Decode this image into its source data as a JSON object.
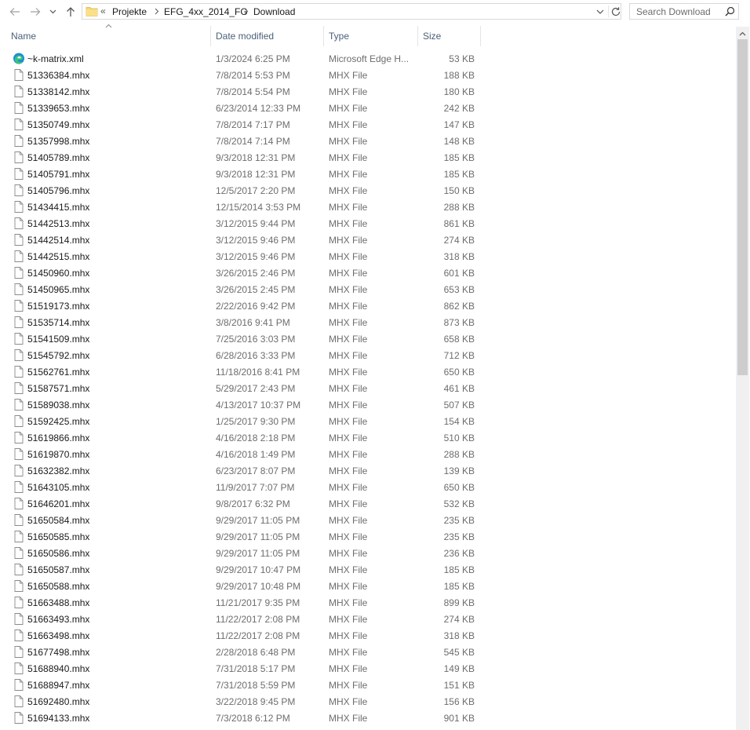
{
  "address": {
    "overflow_chevron": "«",
    "crumbs": [
      "Projekte",
      "EFG_4xx_2014_FG",
      "Download"
    ]
  },
  "search": {
    "placeholder": "Search Download"
  },
  "columns": {
    "name": "Name",
    "date": "Date modified",
    "type": "Type",
    "size": "Size"
  },
  "files": [
    {
      "name": "~k-matrix.xml",
      "date": "1/3/2024 6:25 PM",
      "type": "Microsoft Edge H...",
      "size": "53 KB",
      "icon": "edge-icon"
    },
    {
      "name": "51336384.mhx",
      "date": "7/8/2014 5:53 PM",
      "type": "MHX File",
      "size": "188 KB",
      "icon": "file-icon"
    },
    {
      "name": "51338142.mhx",
      "date": "7/8/2014 5:54 PM",
      "type": "MHX File",
      "size": "180 KB",
      "icon": "file-icon"
    },
    {
      "name": "51339653.mhx",
      "date": "6/23/2014 12:33 PM",
      "type": "MHX File",
      "size": "242 KB",
      "icon": "file-icon"
    },
    {
      "name": "51350749.mhx",
      "date": "7/8/2014 7:17 PM",
      "type": "MHX File",
      "size": "147 KB",
      "icon": "file-icon"
    },
    {
      "name": "51357998.mhx",
      "date": "7/8/2014 7:14 PM",
      "type": "MHX File",
      "size": "148 KB",
      "icon": "file-icon"
    },
    {
      "name": "51405789.mhx",
      "date": "9/3/2018 12:31 PM",
      "type": "MHX File",
      "size": "185 KB",
      "icon": "file-icon"
    },
    {
      "name": "51405791.mhx",
      "date": "9/3/2018 12:31 PM",
      "type": "MHX File",
      "size": "185 KB",
      "icon": "file-icon"
    },
    {
      "name": "51405796.mhx",
      "date": "12/5/2017 2:20 PM",
      "type": "MHX File",
      "size": "150 KB",
      "icon": "file-icon"
    },
    {
      "name": "51434415.mhx",
      "date": "12/15/2014 3:53 PM",
      "type": "MHX File",
      "size": "288 KB",
      "icon": "file-icon"
    },
    {
      "name": "51442513.mhx",
      "date": "3/12/2015 9:44 PM",
      "type": "MHX File",
      "size": "861 KB",
      "icon": "file-icon"
    },
    {
      "name": "51442514.mhx",
      "date": "3/12/2015 9:46 PM",
      "type": "MHX File",
      "size": "274 KB",
      "icon": "file-icon"
    },
    {
      "name": "51442515.mhx",
      "date": "3/12/2015 9:46 PM",
      "type": "MHX File",
      "size": "318 KB",
      "icon": "file-icon"
    },
    {
      "name": "51450960.mhx",
      "date": "3/26/2015 2:46 PM",
      "type": "MHX File",
      "size": "601 KB",
      "icon": "file-icon"
    },
    {
      "name": "51450965.mhx",
      "date": "3/26/2015 2:45 PM",
      "type": "MHX File",
      "size": "653 KB",
      "icon": "file-icon"
    },
    {
      "name": "51519173.mhx",
      "date": "2/22/2016 9:42 PM",
      "type": "MHX File",
      "size": "862 KB",
      "icon": "file-icon"
    },
    {
      "name": "51535714.mhx",
      "date": "3/8/2016 9:41 PM",
      "type": "MHX File",
      "size": "873 KB",
      "icon": "file-icon"
    },
    {
      "name": "51541509.mhx",
      "date": "7/25/2016 3:03 PM",
      "type": "MHX File",
      "size": "658 KB",
      "icon": "file-icon"
    },
    {
      "name": "51545792.mhx",
      "date": "6/28/2016 3:33 PM",
      "type": "MHX File",
      "size": "712 KB",
      "icon": "file-icon"
    },
    {
      "name": "51562761.mhx",
      "date": "11/18/2016 8:41 PM",
      "type": "MHX File",
      "size": "650 KB",
      "icon": "file-icon"
    },
    {
      "name": "51587571.mhx",
      "date": "5/29/2017 2:43 PM",
      "type": "MHX File",
      "size": "461 KB",
      "icon": "file-icon"
    },
    {
      "name": "51589038.mhx",
      "date": "4/13/2017 10:37 PM",
      "type": "MHX File",
      "size": "507 KB",
      "icon": "file-icon"
    },
    {
      "name": "51592425.mhx",
      "date": "1/25/2017 9:30 PM",
      "type": "MHX File",
      "size": "154 KB",
      "icon": "file-icon"
    },
    {
      "name": "51619866.mhx",
      "date": "4/16/2018 2:18 PM",
      "type": "MHX File",
      "size": "510 KB",
      "icon": "file-icon"
    },
    {
      "name": "51619870.mhx",
      "date": "4/16/2018 1:49 PM",
      "type": "MHX File",
      "size": "288 KB",
      "icon": "file-icon"
    },
    {
      "name": "51632382.mhx",
      "date": "6/23/2017 8:07 PM",
      "type": "MHX File",
      "size": "139 KB",
      "icon": "file-icon"
    },
    {
      "name": "51643105.mhx",
      "date": "11/9/2017 7:07 PM",
      "type": "MHX File",
      "size": "650 KB",
      "icon": "file-icon"
    },
    {
      "name": "51646201.mhx",
      "date": "9/8/2017 6:32 PM",
      "type": "MHX File",
      "size": "532 KB",
      "icon": "file-icon"
    },
    {
      "name": "51650584.mhx",
      "date": "9/29/2017 11:05 PM",
      "type": "MHX File",
      "size": "235 KB",
      "icon": "file-icon"
    },
    {
      "name": "51650585.mhx",
      "date": "9/29/2017 11:05 PM",
      "type": "MHX File",
      "size": "235 KB",
      "icon": "file-icon"
    },
    {
      "name": "51650586.mhx",
      "date": "9/29/2017 11:05 PM",
      "type": "MHX File",
      "size": "236 KB",
      "icon": "file-icon"
    },
    {
      "name": "51650587.mhx",
      "date": "9/29/2017 10:47 PM",
      "type": "MHX File",
      "size": "185 KB",
      "icon": "file-icon"
    },
    {
      "name": "51650588.mhx",
      "date": "9/29/2017 10:48 PM",
      "type": "MHX File",
      "size": "185 KB",
      "icon": "file-icon"
    },
    {
      "name": "51663488.mhx",
      "date": "11/21/2017 9:35 PM",
      "type": "MHX File",
      "size": "899 KB",
      "icon": "file-icon"
    },
    {
      "name": "51663493.mhx",
      "date": "11/22/2017 2:08 PM",
      "type": "MHX File",
      "size": "274 KB",
      "icon": "file-icon"
    },
    {
      "name": "51663498.mhx",
      "date": "11/22/2017 2:08 PM",
      "type": "MHX File",
      "size": "318 KB",
      "icon": "file-icon"
    },
    {
      "name": "51677498.mhx",
      "date": "2/28/2018 6:48 PM",
      "type": "MHX File",
      "size": "545 KB",
      "icon": "file-icon"
    },
    {
      "name": "51688940.mhx",
      "date": "7/31/2018 5:17 PM",
      "type": "MHX File",
      "size": "149 KB",
      "icon": "file-icon"
    },
    {
      "name": "51688947.mhx",
      "date": "7/31/2018 5:59 PM",
      "type": "MHX File",
      "size": "151 KB",
      "icon": "file-icon"
    },
    {
      "name": "51692480.mhx",
      "date": "3/22/2018 9:45 PM",
      "type": "MHX File",
      "size": "156 KB",
      "icon": "file-icon"
    },
    {
      "name": "51694133.mhx",
      "date": "7/3/2018 6:12 PM",
      "type": "MHX File",
      "size": "901 KB",
      "icon": "file-icon"
    }
  ]
}
